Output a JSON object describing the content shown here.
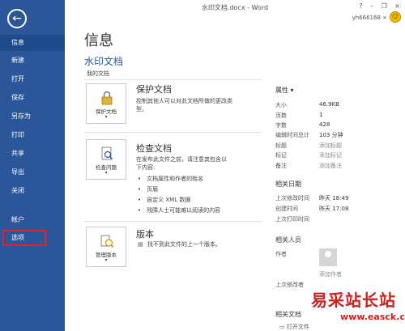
{
  "window": {
    "title": "水印文档.docx - Word",
    "controls": [
      "?",
      "–",
      "❐",
      "×"
    ],
    "user": "yh666168 ×"
  },
  "sidebar": {
    "items": [
      {
        "label": "信息"
      },
      {
        "label": "新建"
      },
      {
        "label": "打开"
      },
      {
        "label": "保存"
      },
      {
        "label": "另存为"
      },
      {
        "label": "打印"
      },
      {
        "label": "共享"
      },
      {
        "label": "导出"
      },
      {
        "label": "关闭"
      },
      {
        "label": "帐户"
      },
      {
        "label": "选项"
      }
    ],
    "active_index": 0,
    "highlighted_index": 10,
    "footer": "..."
  },
  "main": {
    "page_title": "信息",
    "doc_name": "水印文档",
    "doc_location": "我的文档",
    "protect": {
      "button": "保护文档",
      "title": "保护文档",
      "desc": [
        "控制其他人可以对此文档所做的更改类",
        "型。"
      ]
    },
    "inspect": {
      "button": "检查问题",
      "title": "检查文档",
      "desc": [
        "在发布此文件之前，请注意其包含以",
        "下内容:"
      ],
      "bullets": [
        "文档属性和作者的姓名",
        "页眉",
        "自定义 XML 数据",
        "残障人士可能难以阅读的内容"
      ]
    },
    "versions": {
      "button": "管理版本",
      "title": "版本",
      "desc": "找不到此文件的上一个版本。"
    }
  },
  "properties": {
    "title": "属性 ▾",
    "rows": [
      {
        "key": "大小",
        "value": "46.9KB",
        "muted": false
      },
      {
        "key": "页数",
        "value": "1",
        "muted": false
      },
      {
        "key": "字数",
        "value": "428",
        "muted": false
      },
      {
        "key": "编辑时间总计",
        "value": "103 分钟",
        "muted": false
      },
      {
        "key": "标题",
        "value": "添加标题",
        "muted": true
      },
      {
        "key": "标记",
        "value": "添加标记",
        "muted": true
      },
      {
        "key": "备注",
        "value": "添加备注",
        "muted": true
      }
    ],
    "dates_title": "相关日期",
    "dates": [
      {
        "key": "上次修改时间",
        "value": "昨天 18:49"
      },
      {
        "key": "创建时间",
        "value": "昨天 17:08"
      },
      {
        "key": "上次打印时间",
        "value": ""
      }
    ],
    "people_title": "相关人员",
    "author_label": "作者",
    "add_author": "添加作者",
    "last_modified_by": "上次修改者",
    "docs_title": "相关文档",
    "open_location": "打开文件"
  },
  "watermark": {
    "main": "易采站长站",
    "sub": "www.easck.com"
  },
  "colors": {
    "sidebar": "#2b579a",
    "accent": "#2b579a",
    "highlight": "#e6202a",
    "watermark": "#d01f1f"
  }
}
